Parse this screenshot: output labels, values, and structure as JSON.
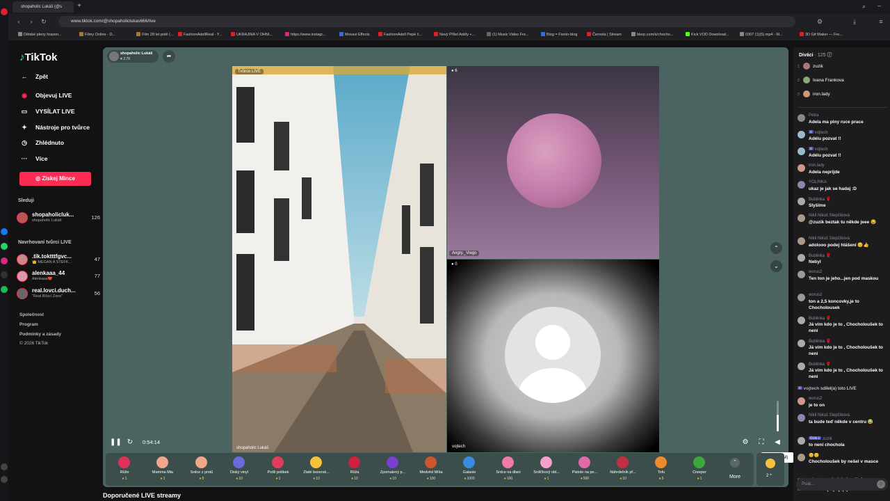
{
  "browser": {
    "tab_title": "shopaholic Lukáš (@s",
    "url": "www.tiktok.com/@shopaholiclukas666/live",
    "bookmarks": [
      "Dětské pleny hrazen...",
      "Filmy Online - D...",
      "Film 28 let poté (...",
      "FashionAdellReal - Y...",
      "UKRAJINA V OHNI...",
      "https://www.instagr...",
      "Movavi Effects",
      "FashionAdell Pepé č...",
      "Nový Přítel Adély +...",
      "(1) Music Video Fre...",
      "Blog = Fionin-blog",
      "Černota | Stream",
      "blerp.com/s/chocho...",
      "Kick VOD Download...",
      "0307 (1)(5).mp4 - M...",
      "3D Gif Maker — Fre..."
    ]
  },
  "nav": {
    "logo": "TikTok",
    "back": "Zpět",
    "items": [
      "Objevuj LIVE",
      "VYSÍLAT LIVE",
      "Nástroje pro tvůrce",
      "Zhlédnuto",
      "Více"
    ],
    "coins_button": "Získej Mince",
    "following_title": "Sleduji",
    "following": [
      {
        "name": "shopaholicluk...",
        "sub": "shopaholic Lukáš",
        "count": "126"
      }
    ],
    "suggested_title": "Navrhovaní tvůrci LIVE",
    "suggested": [
      {
        "name": ".tik.toktttfgvc...",
        "sub": "👑 MEGAN A ŠTEFK...",
        "count": "47"
      },
      {
        "name": "alenkaaa_44",
        "sub": "Alenkaaa❤️",
        "count": "77"
      },
      {
        "name": "real.lovci.duch...",
        "sub": "\"Real Blízcí Zone\"",
        "count": "56"
      }
    ],
    "footer": [
      "Společnost",
      "Program",
      "Podmínky a zásady",
      "© 2026 TikTok"
    ]
  },
  "live": {
    "host_name": "shopaholic Lukáš",
    "host_likes": "♥ 2.7K",
    "creator_label": "Tvůrce LIVE",
    "street_caption": "shopaholic Lukáš",
    "cam_count": "6",
    "cam_name": "Angry._Viego",
    "empty_count": "0",
    "empty_name": "vojtech",
    "timer": "0:54:14",
    "tooltip": "Ztlumit (M)",
    "volume_level": 0.55,
    "more_label": "More",
    "rank_label": "2 ^",
    "recommended_title": "Doporučené LIVE streamy"
  },
  "gifts": [
    {
      "name": "Růže",
      "price": "1",
      "color": "#e0315a"
    },
    {
      "name": "Mamma Mia",
      "price": "1",
      "color": "#f0a68a"
    },
    {
      "name": "Srdce z prstů",
      "price": "5",
      "color": "#f0a68a"
    },
    {
      "name": "Diský vinyl",
      "price": "10",
      "color": "#6a6ad8"
    },
    {
      "name": "Pošli polibek",
      "price": "1",
      "color": "#e03c5c"
    },
    {
      "name": "Zlaté boxersk...",
      "price": "10",
      "color": "#f5c33b"
    },
    {
      "name": "Růža",
      "price": "10",
      "color": "#d02040"
    },
    {
      "name": "Zpomalený p...",
      "price": "10",
      "color": "#7a3fd0"
    },
    {
      "name": "Medvěd Míša",
      "price": "100",
      "color": "#c9582e"
    },
    {
      "name": "Galaxie",
      "price": "1000",
      "color": "#3a8ae0"
    },
    {
      "name": "Srdce na dlani",
      "price": "100",
      "color": "#f07aa8"
    },
    {
      "name": "Srdíčkový obl...",
      "price": "1",
      "color": "#f5a0c8"
    },
    {
      "name": "Pistole na pe...",
      "price": "500",
      "color": "#e06aa8"
    },
    {
      "name": "Náhrdelník př...",
      "price": "10",
      "color": "#c03040"
    },
    {
      "name": "Tofu",
      "price": "5",
      "color": "#f08a2a"
    },
    {
      "name": "Creeper",
      "price": "1",
      "color": "#3aa83a"
    }
  ],
  "chat": {
    "viewers_title": "Diváci",
    "viewers_count": "· 125",
    "top_viewers": [
      "zuzik",
      "Ivana Frankova",
      "iron.lady"
    ],
    "messages": [
      {
        "user": "Petra",
        "text": "Adela ma plny ruce prace",
        "badge": ""
      },
      {
        "user": "vojtech",
        "text": "Adélu pozvat !!",
        "badge": "4"
      },
      {
        "user": "vojtech",
        "text": "Adélu pozvat !!",
        "badge": "4"
      },
      {
        "user": "iron.lady",
        "text": "Adela neprijde",
        "badge": ""
      },
      {
        "user": "YOLINKA",
        "text": "ukaz je jak se hadaj :D",
        "badge": ""
      },
      {
        "user": "Bublinka 🌹",
        "text": "Slyšíme",
        "badge": ""
      },
      {
        "user": "Nikil Nikuš Slepčíková",
        "text": "@zuzik beztak tu někde jeee 😂",
        "badge": ""
      },
      {
        "user": "Nikil Nikuš Slepčíková",
        "text": "adolooo podej hlášení 😊👍",
        "badge": ""
      },
      {
        "user": "Bublinka 🌹",
        "text": "Nebyl",
        "badge": ""
      },
      {
        "user": "worus2",
        "text": "Ten ton je jeho...jen pod maskou",
        "badge": ""
      },
      {
        "user": "worus2",
        "text": "ton a 2,5 koncovky,je to Chocholousek",
        "badge": ""
      },
      {
        "user": "Bublinka 🌹",
        "text": "Já vím kdo je to , Chocholoušek to není",
        "badge": ""
      },
      {
        "user": "Bublinka 🌹",
        "text": "Já vím kdo je to , Chocholoušek to není",
        "badge": ""
      },
      {
        "user": "Bublinka 🌹",
        "text": "Já vím kdo je to , Chocholoušek to není",
        "badge": ""
      }
    ],
    "share_line": {
      "user": "vojtech",
      "badge": "4",
      "text": "sdílel(a) toto LIVE"
    },
    "messages2": [
      {
        "user": "worus2",
        "text": "je to on",
        "badge": ""
      },
      {
        "user": "Nikil Nikuš Slepčíková",
        "text": "ta bude teď někde v centru 😂",
        "badge": ""
      },
      {
        "user": "zuzik",
        "text": "to není chochola",
        "badge": "Číslo 1"
      },
      {
        "user": "😊😊",
        "text": "Chocholoušek by nešel v masce",
        "badge": ""
      }
    ],
    "follow_line": {
      "user": "nekvasilovlasta",
      "text": "sleduje hostitele"
    },
    "join_line": {
      "user": "Martin Loucka",
      "text": "připojil(a) se"
    },
    "input_placeholder": "Psát..."
  }
}
